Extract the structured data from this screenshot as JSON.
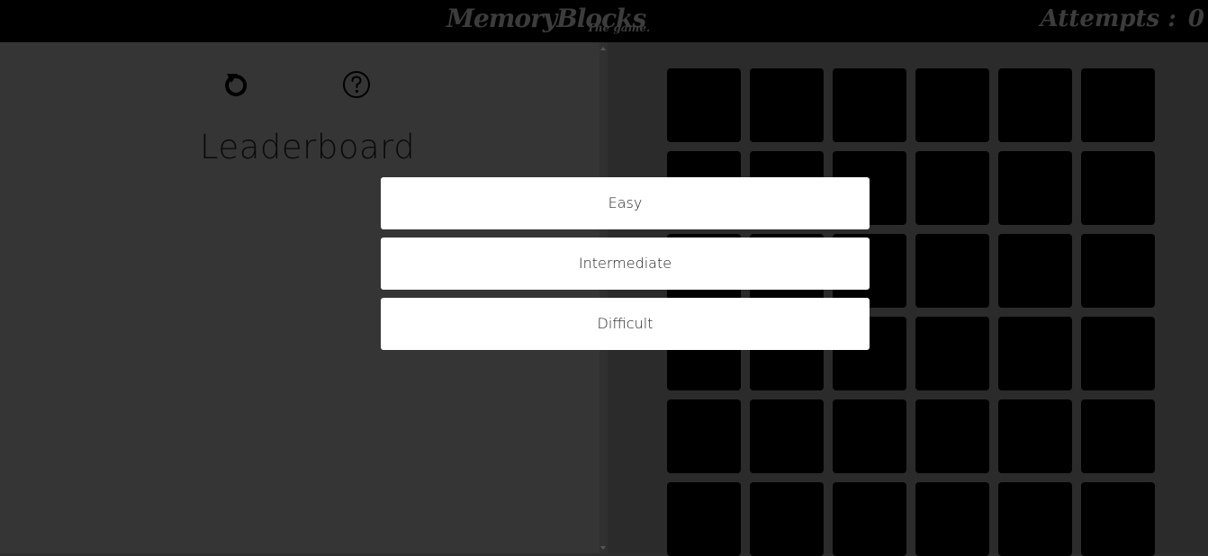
{
  "header": {
    "brand": "MemoryBlocks",
    "brand_sub": "The game.",
    "attempts_label": "Attempts :",
    "attempts_value": "0"
  },
  "left_panel": {
    "restart_icon": "restart-icon",
    "help_icon": "help-question-icon",
    "leaderboard_title": "Leaderboard"
  },
  "board": {
    "columns": 6,
    "rows_visible": 6,
    "tile_color": "#000000"
  },
  "difficulty_menu": {
    "options": [
      "Easy",
      "Intermediate",
      "Difficult"
    ]
  },
  "colors": {
    "topbar": "#000000",
    "left_panel": "#353535",
    "right_panel": "#2b2b2b",
    "brand_text": "#3c3c3c"
  }
}
